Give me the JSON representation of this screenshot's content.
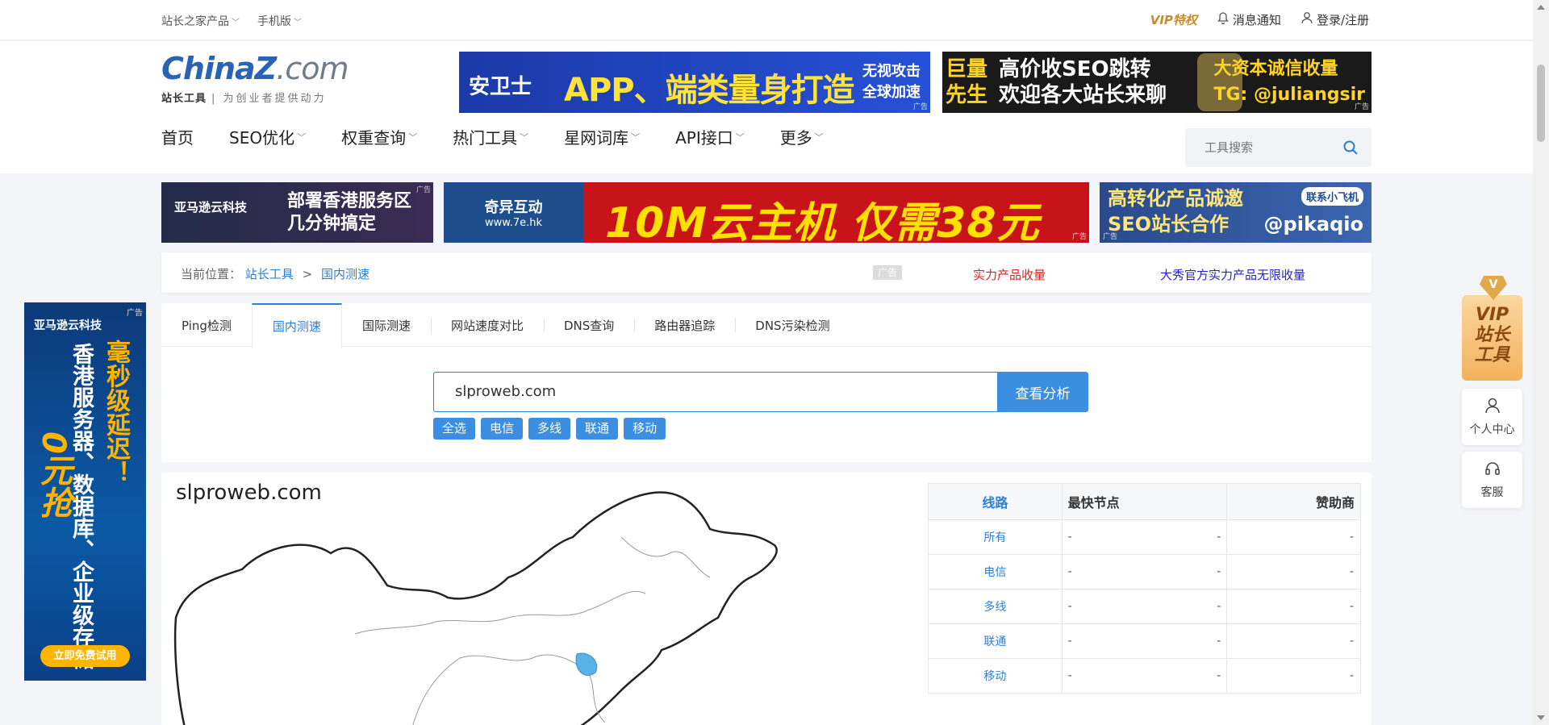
{
  "topbar": {
    "products": "站长之家产品",
    "mobile": "手机版",
    "vip": "VIP特权",
    "notify": "消息通知",
    "login": "登录/注册"
  },
  "logo": {
    "brand_a": "China",
    "brand_z": "Z",
    "brand_dom": ".com",
    "tag_bold": "站长工具",
    "tag": "| 为创业者提供动力"
  },
  "ads": {
    "ad1_brand": "安卫士",
    "ad1_main": "APP、端类量身打造",
    "ad1_sub1": "无视攻击",
    "ad1_sub2": "全球加速",
    "ad2_l1": "巨量",
    "ad2_l2": "先生",
    "ad2_m1": "高价收SEO跳转",
    "ad2_m2": "欢迎各大站长来聊",
    "ad2_r1": "大资本诚信收量",
    "ad2_r2": "TG: @juliangsir",
    "ad3_a": "亚马逊云科技",
    "ad3_b1": "部署香港服务区",
    "ad3_b2": "几分钟搞定",
    "ad4_logo": "奇异互动",
    "ad4_url": "www.7e.hk",
    "ad4_main_a": "10M云主机 仅需",
    "ad4_main_b": "38",
    "ad4_main_c": "元",
    "ad5_a1": "高转化产品诚邀",
    "ad5_a2": "SEO站长合作",
    "ad5_contact": "联系小飞机",
    "ad5_handle": "@pikaqio",
    "flag": "广告"
  },
  "nav": [
    {
      "label": "首页",
      "caret": false
    },
    {
      "label": "SEO优化",
      "caret": true
    },
    {
      "label": "权重查询",
      "caret": true
    },
    {
      "label": "热门工具",
      "caret": true
    },
    {
      "label": "星网词库",
      "caret": true
    },
    {
      "label": "API接口",
      "caret": true
    },
    {
      "label": "更多",
      "caret": true
    }
  ],
  "search": {
    "placeholder": "工具搜索"
  },
  "breadcrumb": {
    "prefix": "当前位置：",
    "home": "站长工具",
    "sep": ">",
    "current": "国内测速",
    "ad_tag": "广告",
    "link1": "实力产品收量",
    "link2": "大秀官方实力产品无限收量"
  },
  "tabs": [
    "Ping检测",
    "国内测速",
    "国际测速",
    "网站速度对比",
    "DNS查询",
    "路由器追踪",
    "DNS污染检测"
  ],
  "query": {
    "value": "slproweb.com",
    "button": "查看分析",
    "chips": [
      "全选",
      "电信",
      "多线",
      "联通",
      "移动"
    ]
  },
  "results": {
    "domain": "slproweb.com",
    "headers": [
      "线路",
      "最快节点",
      "赞助商"
    ],
    "rows": [
      {
        "line": "所有",
        "node": "-",
        "node2": "-",
        "sponsor": "-"
      },
      {
        "line": "电信",
        "node": "-",
        "node2": "-",
        "sponsor": "-"
      },
      {
        "line": "多线",
        "node": "-",
        "node2": "-",
        "sponsor": "-"
      },
      {
        "line": "联通",
        "node": "-",
        "node2": "-",
        "sponsor": "-"
      },
      {
        "line": "移动",
        "node": "-",
        "node2": "-",
        "sponsor": "-"
      }
    ]
  },
  "side_ad": {
    "top": "亚马逊云科技",
    "v1": "香港服务器、数据库、企业级存储",
    "v2": "毫秒级延迟！",
    "zero": "0元抢",
    "btn": "立即免费试用",
    "flag": "广告"
  },
  "float": {
    "vip_gem": "V",
    "vip_text1": "VIP",
    "vip_text2": "站长",
    "vip_text3": "工具",
    "personal": "个人中心",
    "service": "客服"
  }
}
